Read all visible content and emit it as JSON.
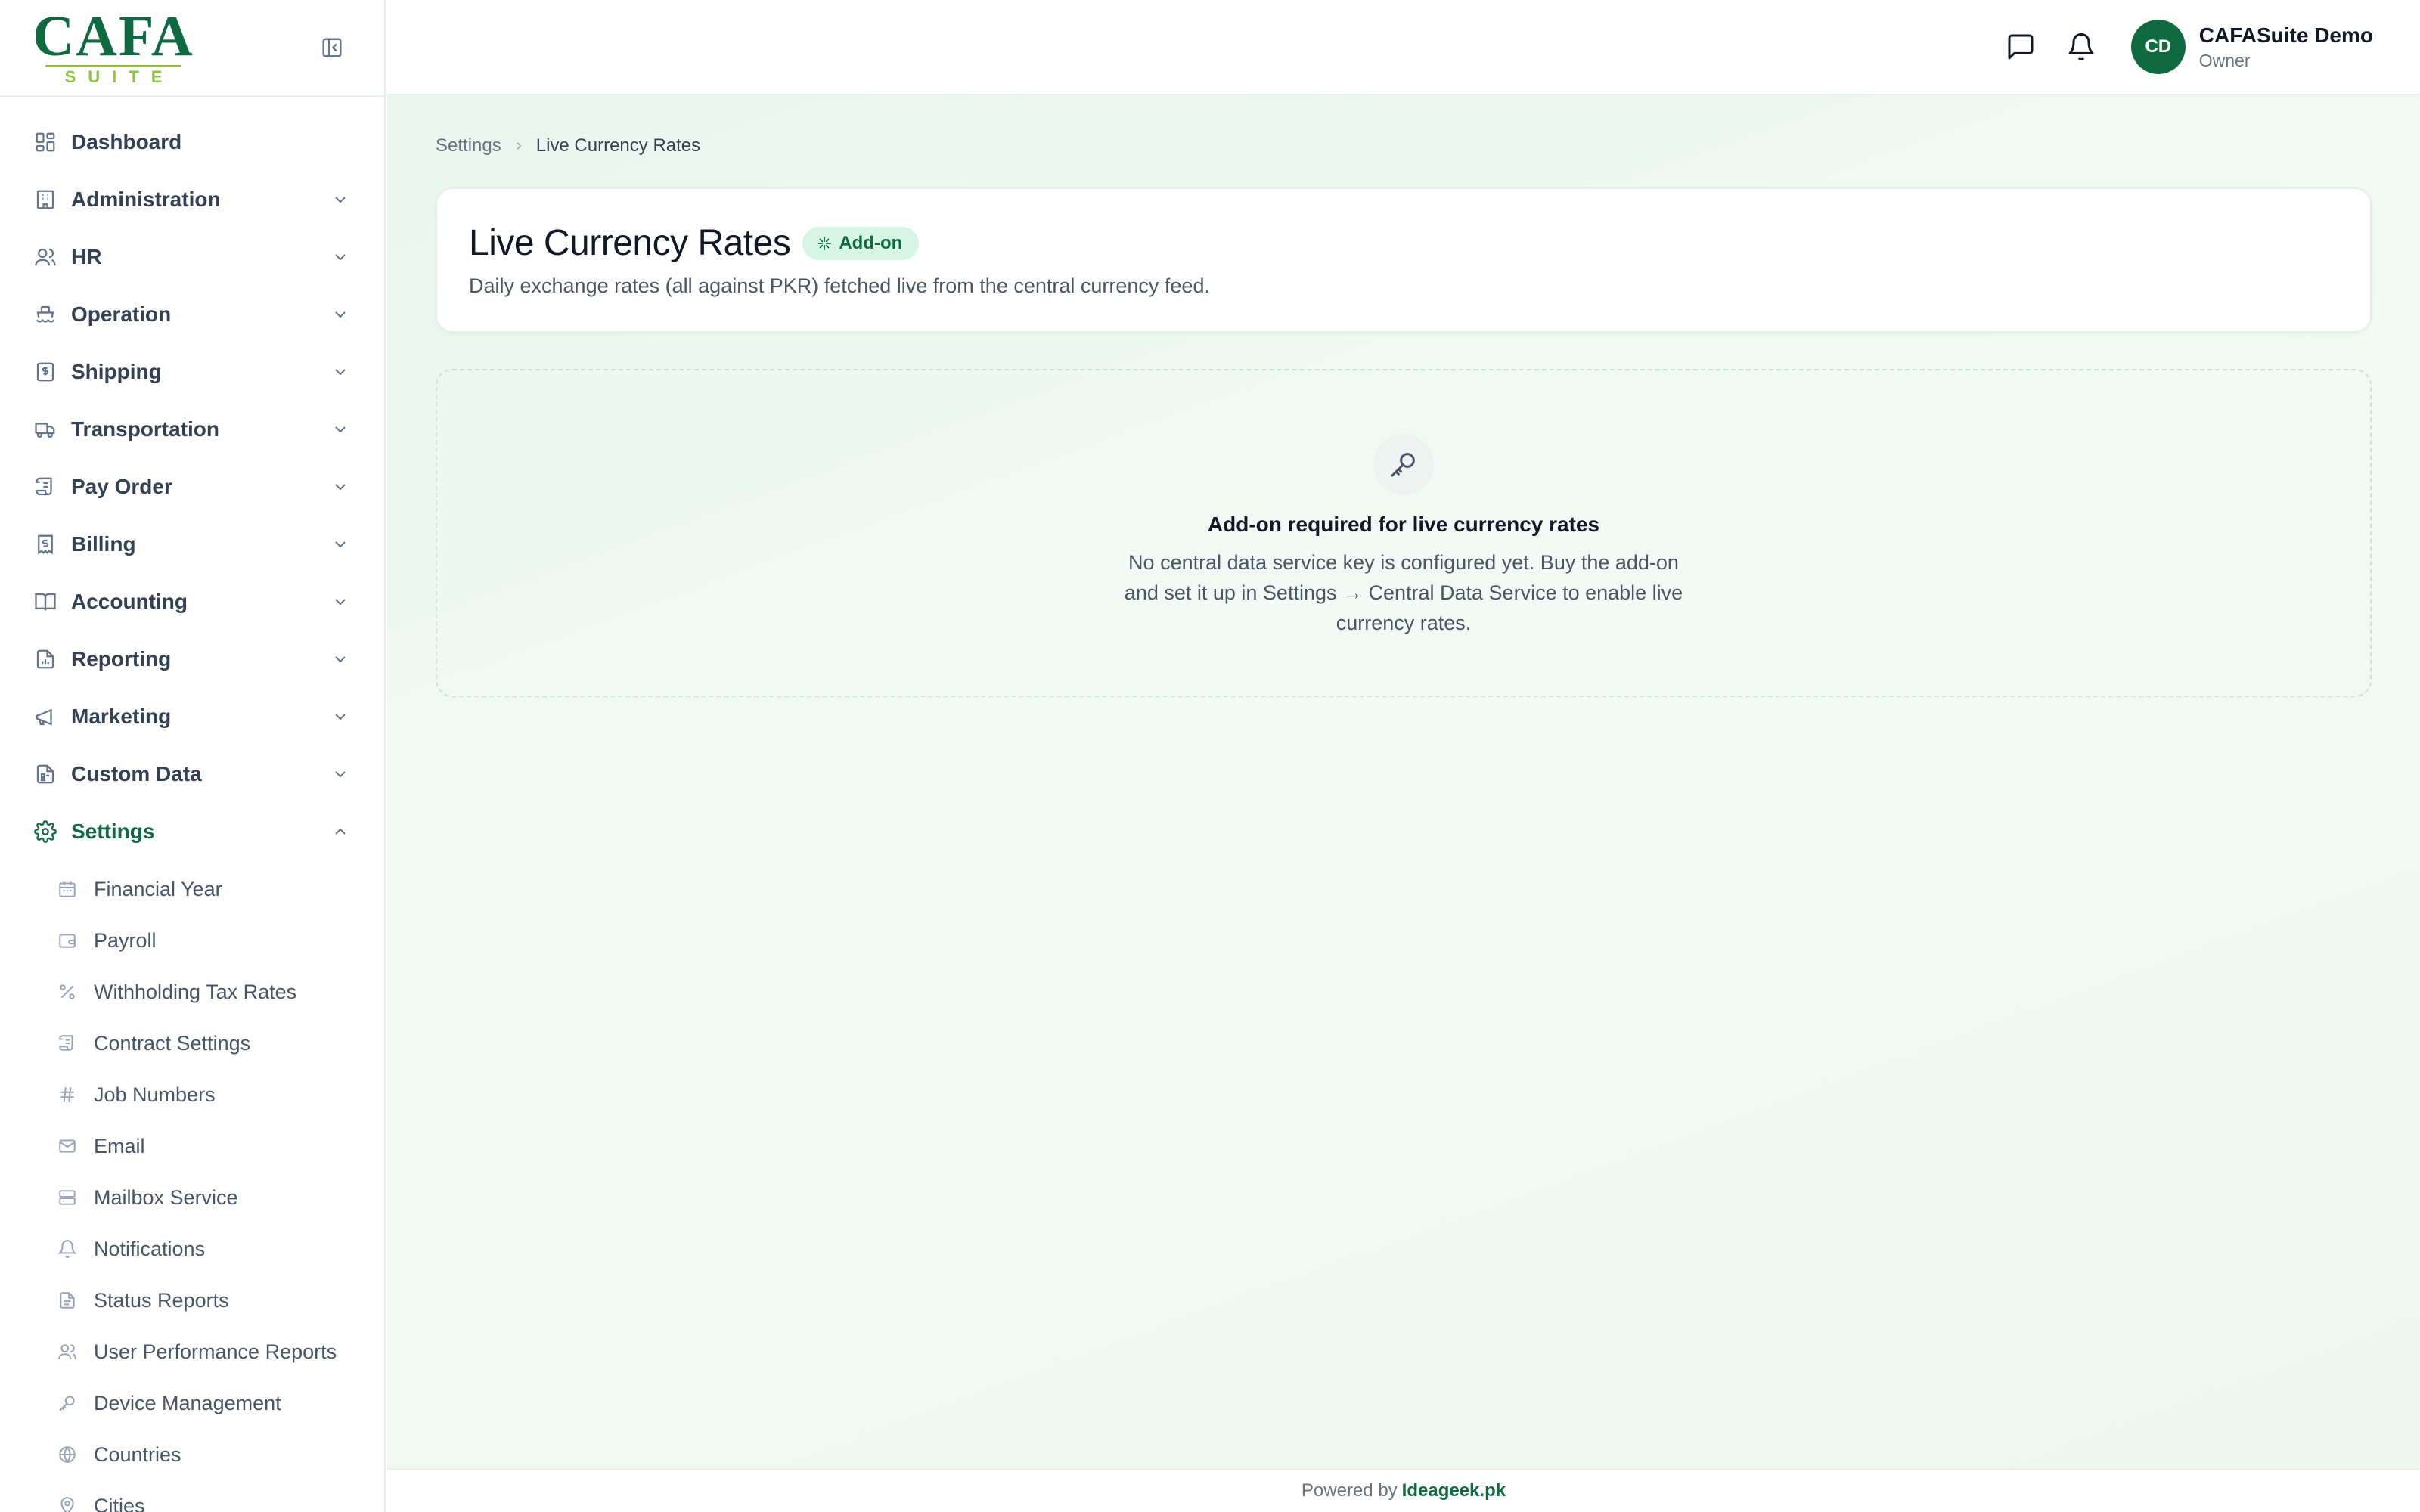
{
  "logo": {
    "main": "CAFA",
    "sub": "SUITE"
  },
  "sidebar": {
    "items": [
      {
        "label": "Dashboard",
        "icon": "dashboard-icon"
      },
      {
        "label": "Administration",
        "icon": "building-icon"
      },
      {
        "label": "HR",
        "icon": "users-icon"
      },
      {
        "label": "Operation",
        "icon": "ship-icon"
      },
      {
        "label": "Shipping",
        "icon": "dollar-doc-icon"
      },
      {
        "label": "Transportation",
        "icon": "truck-icon"
      },
      {
        "label": "Pay Order",
        "icon": "scroll-icon"
      },
      {
        "label": "Billing",
        "icon": "receipt-icon"
      },
      {
        "label": "Accounting",
        "icon": "book-icon"
      },
      {
        "label": "Reporting",
        "icon": "chart-doc-icon"
      },
      {
        "label": "Marketing",
        "icon": "megaphone-icon"
      },
      {
        "label": "Custom Data",
        "icon": "form-doc-icon"
      },
      {
        "label": "Settings",
        "icon": "gear-icon"
      }
    ],
    "settings_sub": [
      {
        "label": "Financial Year",
        "icon": "calendar-icon"
      },
      {
        "label": "Payroll",
        "icon": "wallet-icon"
      },
      {
        "label": "Withholding Tax Rates",
        "icon": "percent-icon"
      },
      {
        "label": "Contract Settings",
        "icon": "scroll-icon"
      },
      {
        "label": "Job Numbers",
        "icon": "hash-icon"
      },
      {
        "label": "Email",
        "icon": "mail-icon"
      },
      {
        "label": "Mailbox Service",
        "icon": "server-icon"
      },
      {
        "label": "Notifications",
        "icon": "bell-icon"
      },
      {
        "label": "Status Reports",
        "icon": "file-icon"
      },
      {
        "label": "User Performance Reports",
        "icon": "users-icon"
      },
      {
        "label": "Device Management",
        "icon": "key-icon"
      },
      {
        "label": "Countries",
        "icon": "globe-icon"
      },
      {
        "label": "Cities",
        "icon": "pin-icon"
      }
    ]
  },
  "topbar": {
    "user": {
      "initials": "CD",
      "name": "CAFASuite Demo",
      "role": "Owner"
    }
  },
  "breadcrumb": {
    "parent": "Settings",
    "current": "Live Currency Rates"
  },
  "page": {
    "title": "Live Currency Rates",
    "badge": "Add-on",
    "description": "Daily exchange rates (all against PKR) fetched live from the central currency feed."
  },
  "empty_state": {
    "title": "Add-on required for live currency rates",
    "text": "No central data service key is configured yet. Buy the add-on and set it up in Settings → Central Data Service to enable live currency rates."
  },
  "footer": {
    "prefix": "Powered by",
    "brand": "Ideageek.pk"
  },
  "colors": {
    "brand": "#0f6b3f",
    "accent": "#8cc63f",
    "badge_bg": "#d6f5e3"
  }
}
